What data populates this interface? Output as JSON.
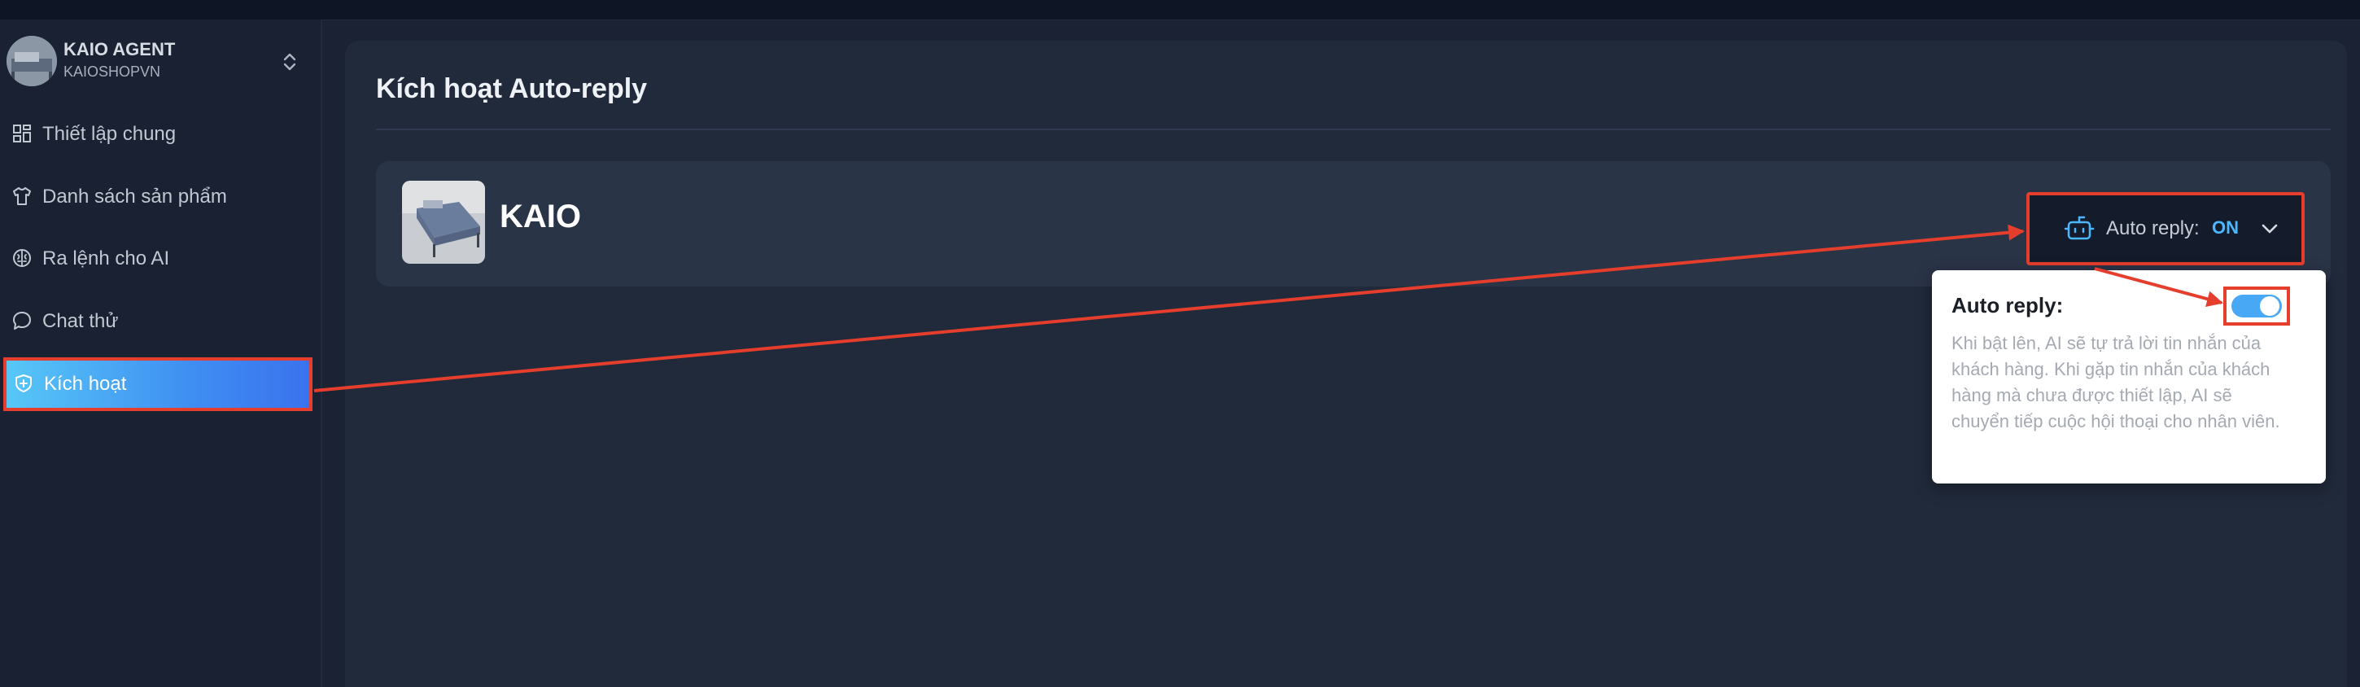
{
  "account": {
    "name": "KAIO AGENT",
    "shop": "KAIOSHOPVN"
  },
  "sidebar": {
    "items": [
      {
        "label": "Thiết lập chung",
        "icon": "grid-icon",
        "active": false
      },
      {
        "label": "Danh sách sản phẩm",
        "icon": "shirt-icon",
        "active": false
      },
      {
        "label": "Ra lệnh cho AI",
        "icon": "brain-icon",
        "active": false
      },
      {
        "label": "Chat thử",
        "icon": "chat-bubble-icon",
        "active": false
      },
      {
        "label": "Kích hoạt",
        "icon": "shield-icon",
        "active": true
      }
    ]
  },
  "main": {
    "title": "Kích hoạt Auto-reply",
    "bot": {
      "name": "KAIO"
    },
    "auto_reply": {
      "label": "Auto reply:",
      "value": "ON",
      "icon": "robot-icon"
    }
  },
  "popover": {
    "title": "Auto reply:",
    "description": "Khi bật lên, AI sẽ tự trả lời tin nhắn của khách hàng. Khi gặp tin nhắn của khách hàng mà chưa được thiết lập, AI sẽ chuyển tiếp cuộc hội thoại cho nhân viên.",
    "toggle_on": true
  },
  "colors": {
    "accent": "#3f8ff2",
    "annotation": "#e53e2d",
    "on_value": "#4ab7ff"
  }
}
